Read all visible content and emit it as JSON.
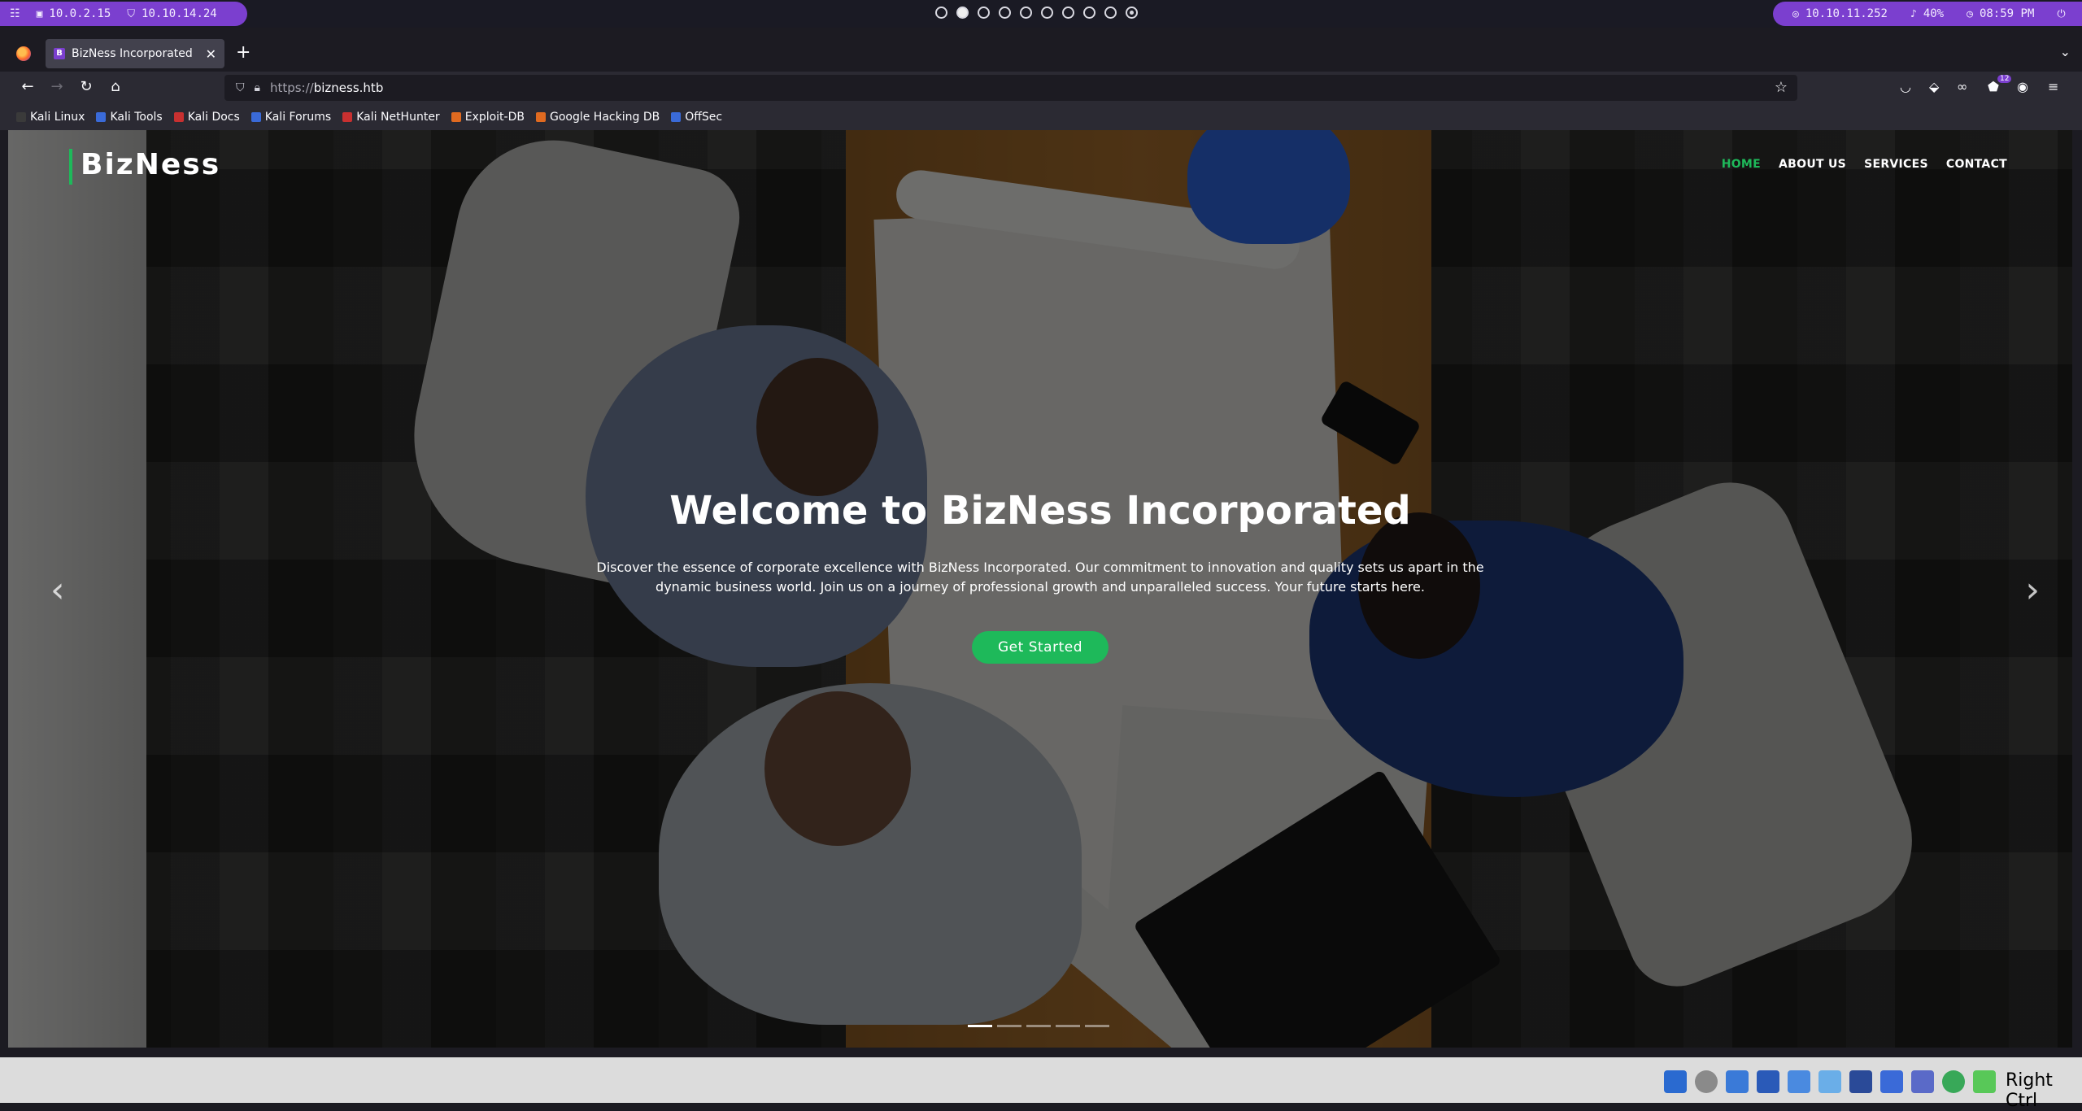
{
  "topbar": {
    "left_items": [
      {
        "icon": "menu-grid-icon",
        "text": ""
      },
      {
        "icon": "monitor-icon",
        "text": "10.0.2.15"
      },
      {
        "icon": "shield-icon",
        "text": "10.10.14.24"
      }
    ],
    "right_items": [
      {
        "icon": "target-icon",
        "text": "10.10.11.252"
      },
      {
        "icon": "volume-icon",
        "text": "40%"
      },
      {
        "icon": "clock-icon",
        "text": "08:59 PM"
      }
    ],
    "workspaces": {
      "count": 10,
      "active_index": 1
    }
  },
  "browser": {
    "tab": {
      "favicon_letter": "B",
      "title": "BizNess Incorporated"
    },
    "url": {
      "scheme": "https://",
      "host": "bizness.htb"
    },
    "extension_badge": "12",
    "bookmarks": [
      {
        "label": "Kali Linux",
        "color": "#3a3a3a"
      },
      {
        "label": "Kali Tools",
        "color": "#3a6ad8"
      },
      {
        "label": "Kali Docs",
        "color": "#c83030"
      },
      {
        "label": "Kali Forums",
        "color": "#3a6ad8"
      },
      {
        "label": "Kali NetHunter",
        "color": "#c83030"
      },
      {
        "label": "Exploit-DB",
        "color": "#e06a20"
      },
      {
        "label": "Google Hacking DB",
        "color": "#e06a20"
      },
      {
        "label": "OffSec",
        "color": "#3a6ad8"
      }
    ]
  },
  "site": {
    "logo": "BizNess",
    "nav": [
      "HOME",
      "ABOUT US",
      "SERVICES",
      "CONTACT"
    ],
    "active_nav_index": 0,
    "hero": {
      "title": "Welcome to BizNess Incorporated",
      "text": "Discover the essence of corporate excellence with BizNess Incorporated. Our commitment to innovation and quality sets us apart in the dynamic business world. Join us on a journey of professional growth and unparalleled success. Your future starts here.",
      "button": "Get Started"
    },
    "carousel": {
      "prev": "‹",
      "next": "›",
      "slides": 5,
      "active_slide": 0
    },
    "accent_color": "#1eb95a"
  },
  "host": {
    "key_label": "Right Ctrl"
  }
}
